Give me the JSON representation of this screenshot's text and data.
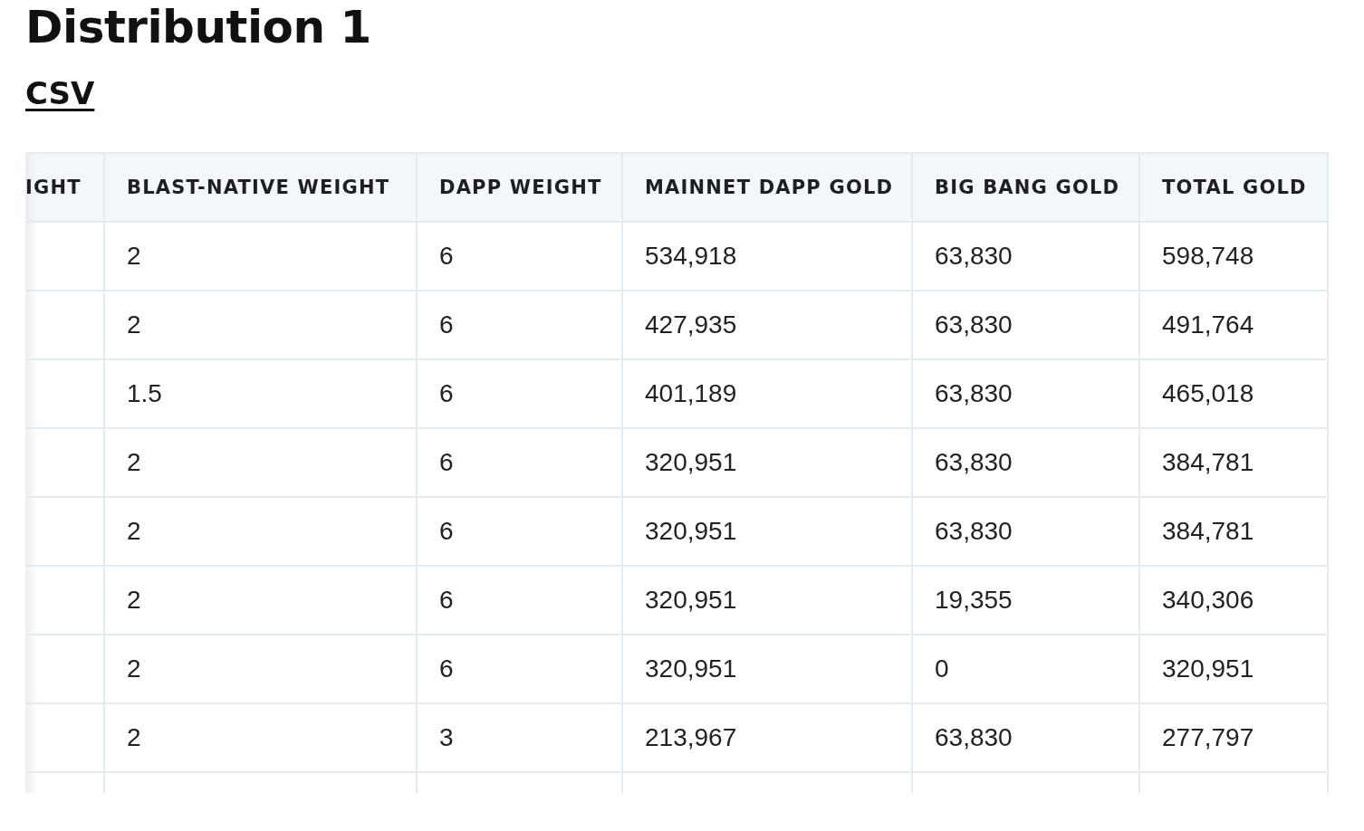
{
  "title": "Distribution 1",
  "link": "CSV",
  "table": {
    "columns": [
      "IGHT",
      "BLAST-NATIVE WEIGHT",
      "DAPP WEIGHT",
      "MAINNET DAPP GOLD",
      "BIG BANG GOLD",
      "TOTAL GOLD"
    ],
    "rows": [
      [
        "",
        "2",
        "6",
        "534,918",
        "63,830",
        "598,748"
      ],
      [
        "",
        "2",
        "6",
        "427,935",
        "63,830",
        "491,764"
      ],
      [
        "",
        "1.5",
        "6",
        "401,189",
        "63,830",
        "465,018"
      ],
      [
        "",
        "2",
        "6",
        "320,951",
        "63,830",
        "384,781"
      ],
      [
        "",
        "2",
        "6",
        "320,951",
        "63,830",
        "384,781"
      ],
      [
        "",
        "2",
        "6",
        "320,951",
        "19,355",
        "340,306"
      ],
      [
        "",
        "2",
        "6",
        "320,951",
        "0",
        "320,951"
      ],
      [
        "",
        "2",
        "3",
        "213,967",
        "63,830",
        "277,797"
      ]
    ]
  }
}
